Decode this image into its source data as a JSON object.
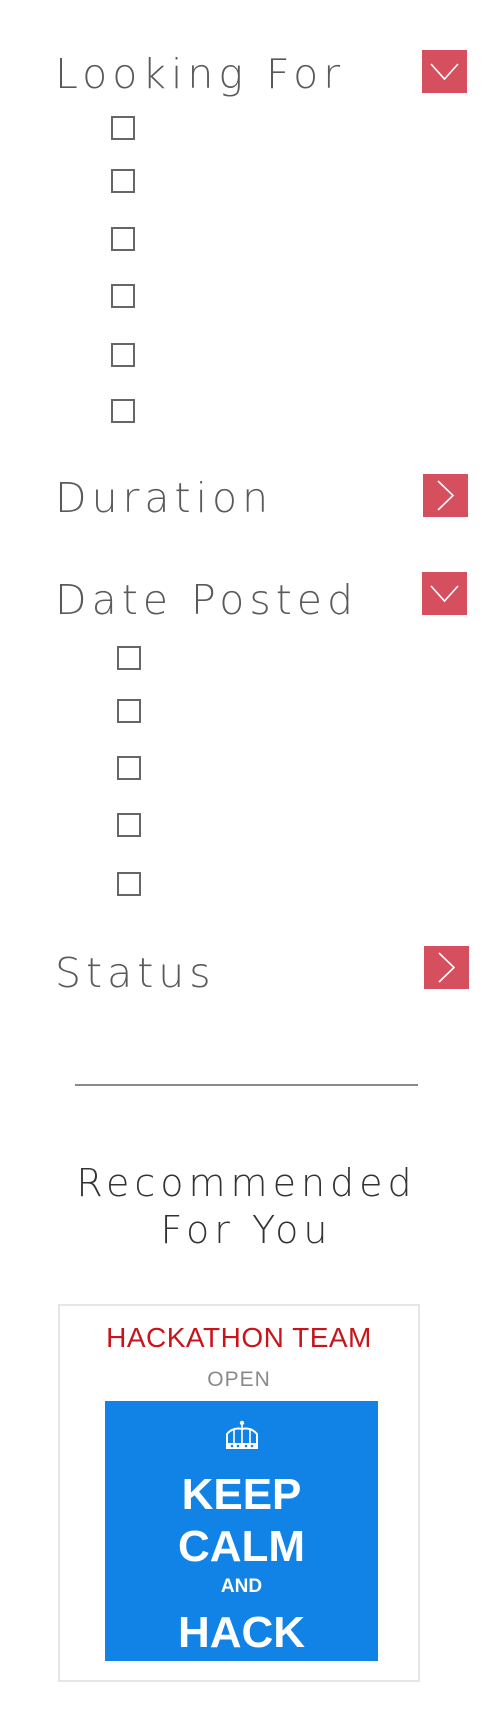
{
  "filters": {
    "looking_for": {
      "title": "Looking For",
      "expanded": true,
      "toggle_icon": "chevron-down-icon",
      "option_count_checkboxes": 6
    },
    "duration": {
      "title": "Duration",
      "expanded": false,
      "toggle_icon": "chevron-right-icon"
    },
    "date_posted": {
      "title": "Date Posted",
      "expanded": true,
      "toggle_icon": "chevron-down-icon"
    },
    "status": {
      "title": "Status",
      "expanded": false,
      "toggle_icon": "chevron-right-icon"
    }
  },
  "recommended": {
    "title_line1": "Recommended",
    "title_line2": "For You",
    "cards": [
      {
        "title": "HACKATHON TEAM",
        "status": "OPEN",
        "poster": {
          "icon": "crown-icon",
          "line1": "KEEP",
          "line2": "CALM",
          "line3": "AND",
          "line4": "HACK"
        }
      }
    ]
  },
  "colors": {
    "accent": "#d64f5e",
    "card_title": "#c8151b",
    "poster_bg": "#1283e6"
  }
}
